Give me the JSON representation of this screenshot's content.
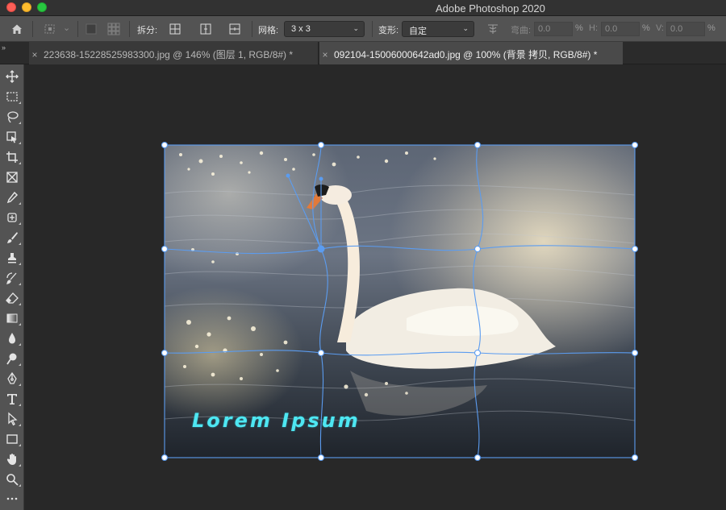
{
  "window": {
    "app_title": "Adobe Photoshop 2020"
  },
  "options_bar": {
    "split_label": "拆分:",
    "grid_label": "网格:",
    "grid_value": "3 x 3",
    "warp_label": "变形:",
    "warp_value": "自定",
    "bend_label": "弯曲:",
    "bend_value": "0.0",
    "h_label": "H:",
    "h_value": "0.0",
    "v_label": "V:",
    "v_value": "0.0",
    "percent": "%"
  },
  "tabs": [
    {
      "label": "223638-15228525983300.jpg @ 146% (图层 1, RGB/8#) *",
      "active": false
    },
    {
      "label": "092104-15006000642ad0.jpg @ 100% (背景 拷贝, RGB/8#) *",
      "active": true
    }
  ],
  "tools": [
    "move-tool",
    "marquee-tool",
    "lasso-tool",
    "object-select-tool",
    "crop-tool",
    "frame-tool",
    "eyedropper-tool",
    "healing-brush-tool",
    "brush-tool",
    "clone-stamp-tool",
    "history-brush-tool",
    "eraser-tool",
    "gradient-tool",
    "blur-tool",
    "dodge-tool",
    "pen-tool",
    "type-tool",
    "path-select-tool",
    "rectangle-tool",
    "hand-tool",
    "zoom-tool",
    "more-tools"
  ],
  "canvas": {
    "overlay_text": "Lorem Ipsum"
  },
  "colors": {
    "accent": "#5b9cf0",
    "overlay_text": "#4ee7f2"
  }
}
